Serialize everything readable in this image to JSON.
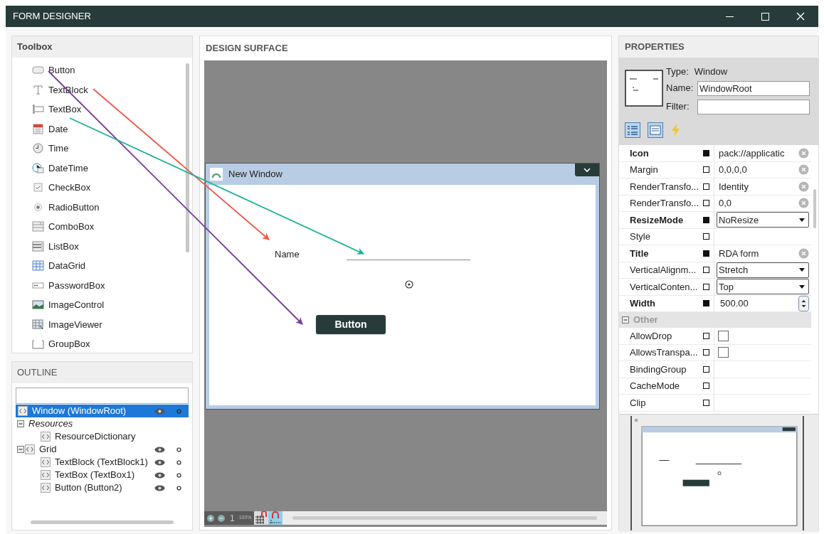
{
  "window": {
    "title": "FORM DESIGNER"
  },
  "toolbox": {
    "title": "Toolbox",
    "items": [
      {
        "label": "Button",
        "kind": "button"
      },
      {
        "label": "TextBlock",
        "kind": "textblock"
      },
      {
        "label": "TextBox",
        "kind": "textbox"
      },
      {
        "label": "Date",
        "kind": "date"
      },
      {
        "label": "Time",
        "kind": "time"
      },
      {
        "label": "DateTime",
        "kind": "datetime"
      },
      {
        "label": "CheckBox",
        "kind": "checkbox"
      },
      {
        "label": "RadioButton",
        "kind": "radio"
      },
      {
        "label": "ComboBox",
        "kind": "combobox"
      },
      {
        "label": "ListBox",
        "kind": "listbox"
      },
      {
        "label": "DataGrid",
        "kind": "datagrid"
      },
      {
        "label": "PasswordBox",
        "kind": "password"
      },
      {
        "label": "ImageControl",
        "kind": "image"
      },
      {
        "label": "ImageViewer",
        "kind": "imageviewer"
      },
      {
        "label": "GroupBox",
        "kind": "groupbox"
      }
    ]
  },
  "outline": {
    "title": "OUTLINE",
    "tree": [
      {
        "label": "Window (WindowRoot)",
        "kind": "element",
        "selected": true
      },
      {
        "label": "Resources",
        "kind": "group",
        "selected": false,
        "expanded": true,
        "children": [
          {
            "label": "ResourceDictionary",
            "kind": "resource",
            "selected": false
          }
        ]
      },
      {
        "label": "Grid",
        "kind": "element",
        "selected": false,
        "expanded": true,
        "children": [
          {
            "label": "TextBlock (TextBlock1)",
            "kind": "element",
            "selected": false
          },
          {
            "label": "TextBox (TextBox1)",
            "kind": "element",
            "selected": false
          },
          {
            "label": "Button (Button2)",
            "kind": "element",
            "selected": false
          }
        ]
      }
    ]
  },
  "design_surface": {
    "title": "DESIGN SURFACE",
    "form": {
      "title": "New Window",
      "label": "Name",
      "button": "Button"
    },
    "toolbar": {
      "zoom_step": "1",
      "zoom_percent": "100%"
    }
  },
  "properties": {
    "title": "PROPERTIES",
    "type_label": "Type:",
    "type_value": "Window",
    "name_label": "Name:",
    "name_value": "WindowRoot",
    "filter_label": "Filter:",
    "rows": [
      {
        "kind": "clearable",
        "name": "Icon",
        "set": true,
        "value": "pack://applicatic"
      },
      {
        "kind": "clearable",
        "name": "Margin",
        "set": false,
        "value": "0,0,0,0"
      },
      {
        "kind": "clearable",
        "name": "RenderTransfo...",
        "set": false,
        "value": "Identity"
      },
      {
        "kind": "clearable",
        "name": "RenderTransfo...",
        "set": false,
        "value": "0,0"
      },
      {
        "kind": "dropdown",
        "name": "ResizeMode",
        "set": true,
        "value": "NoResize"
      },
      {
        "kind": "empty",
        "name": "Style",
        "set": false
      },
      {
        "kind": "clearable",
        "name": "Title",
        "set": true,
        "value": "RDA form"
      },
      {
        "kind": "dropdown",
        "name": "VerticalAlignm...",
        "set": false,
        "value": "Stretch"
      },
      {
        "kind": "dropdown",
        "name": "VerticalConten...",
        "set": false,
        "value": "Top"
      },
      {
        "kind": "spinner",
        "name": "Width",
        "set": true,
        "value": "500.00"
      },
      {
        "kind": "category",
        "name": "Other",
        "expanded": true
      },
      {
        "kind": "checkbox",
        "name": "AllowDrop",
        "set": false,
        "checked": false
      },
      {
        "kind": "checkbox",
        "name": "AllowsTranspa...",
        "set": false,
        "checked": false
      },
      {
        "kind": "empty",
        "name": "BindingGroup",
        "set": false
      },
      {
        "kind": "empty",
        "name": "CacheMode",
        "set": false
      },
      {
        "kind": "empty",
        "name": "Clip",
        "set": false
      }
    ]
  }
}
